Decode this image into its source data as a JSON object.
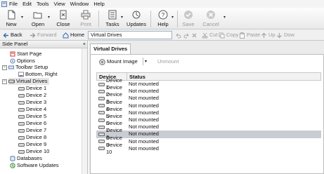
{
  "menubar": {
    "items": [
      {
        "label": "File"
      },
      {
        "label": "Edit"
      },
      {
        "label": "Tools"
      },
      {
        "label": "View"
      },
      {
        "label": "Window"
      },
      {
        "label": "Help"
      }
    ]
  },
  "toolbar": {
    "new_label": "New",
    "open_label": "Open",
    "close_label": "Close",
    "print_label": "Print",
    "tasks_label": "Tasks",
    "updates_label": "Updates",
    "help_label": "Help",
    "save_label": "Save",
    "cancel_label": "Cancel"
  },
  "navbar": {
    "back": "Back",
    "forward": "Forward",
    "home": "Home",
    "address": "Virtual Drives",
    "cut": "Cut",
    "copy": "Copy",
    "paste": "Paste",
    "up": "Up",
    "down": "Dow"
  },
  "sidepanel": {
    "title": "Side Panel",
    "close": "×",
    "start_page": "Start Page",
    "options": "Options",
    "toolbar_setup": "Toolbar Setup",
    "bottom_right": "Bottom, Right",
    "virtual_drives": "Virtual Drives",
    "devices": [
      "Device 1",
      "Device 2",
      "Device 3",
      "Device 4",
      "Device 5",
      "Device 6",
      "Device 7",
      "Device 8",
      "Device 9",
      "Device 10"
    ],
    "databases": "Databases",
    "software_updates": "Software Updates"
  },
  "main": {
    "tab": "Virtual Drives",
    "mount_image": "Mount Image",
    "unmount": "Unmount",
    "columns": {
      "device": "Device",
      "status": "Status"
    },
    "rows": [
      {
        "device": "Device 1",
        "status": "Not mounted"
      },
      {
        "device": "Device 2",
        "status": "Not mounted"
      },
      {
        "device": "Device 3",
        "status": "Not mounted"
      },
      {
        "device": "Device 4",
        "status": "Not mounted"
      },
      {
        "device": "Device 5",
        "status": "Not mounted"
      },
      {
        "device": "Device 6",
        "status": "Not mounted"
      },
      {
        "device": "Device 7",
        "status": "Not mounted"
      },
      {
        "device": "Device 8",
        "status": "Not mounted"
      },
      {
        "device": "Device 9",
        "status": "Not mounted"
      },
      {
        "device": "Device 10",
        "status": "Not mounted"
      }
    ],
    "selected_row": 7
  }
}
